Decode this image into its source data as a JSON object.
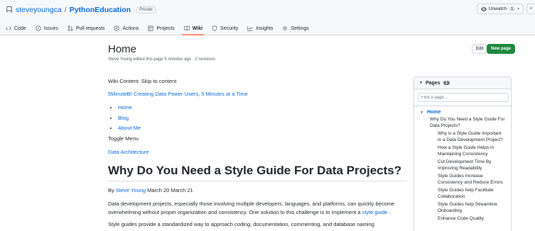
{
  "repo": {
    "owner": "steveyoungca",
    "separator": "/",
    "name": "PythonEducation",
    "visibility": "Private",
    "unwatch_label": "Unwatch",
    "watch_count": "1",
    "fork_partial": "⑂"
  },
  "nav": {
    "tabs": [
      {
        "label": "Code",
        "icon": "code-icon"
      },
      {
        "label": "Issues",
        "icon": "issue-icon"
      },
      {
        "label": "Pull requests",
        "icon": "pull-request-icon"
      },
      {
        "label": "Actions",
        "icon": "play-icon"
      },
      {
        "label": "Projects",
        "icon": "table-icon"
      },
      {
        "label": "Wiki",
        "icon": "book-icon",
        "active": true
      },
      {
        "label": "Security",
        "icon": "shield-icon"
      },
      {
        "label": "Insights",
        "icon": "graph-icon"
      },
      {
        "label": "Settings",
        "icon": "gear-icon"
      }
    ],
    "accent": "#fd8c73"
  },
  "page": {
    "title": "Home",
    "meta": "Steve Young edited this page 5 minutes ago · 2 revisions",
    "edit_label": "Edit",
    "new_page_label": "New page"
  },
  "content": {
    "skip": "Wiki Content: Skip to content",
    "site_link": "5MinuteBI Creating Data Power Users, 5 Minutes at a Time",
    "menu": [
      "Home",
      "Blog",
      "About Me"
    ],
    "toggle": "Toggle Menu",
    "data_arch": "Data Architecture",
    "heading": "Why Do You Need a Style Guide For Data Projects?",
    "by_prefix": "By",
    "author": "Steve Young",
    "dates": "March 20 March 21",
    "p1_text": "Data development projects, especially those involving multiple developers, languages, and platforms, can quickly become overwhelming without proper organization and consistency. One solution to this challenge is to implement a",
    "p1_link": "style guide",
    "p1_end": ".",
    "p2_text": "Style guides provide a standardized way to approach coding, documentation, commenting, and database naming"
  },
  "sidebar": {
    "title": "Pages",
    "count": "1",
    "search_placeholder": "Find a page…",
    "home": "Home",
    "items": [
      {
        "level": 1,
        "label": "Why Do You Need a Style Guide For Data Projects?"
      },
      {
        "level": 2,
        "label": "Why is a Style Guide Important in a Data Development Project?"
      },
      {
        "level": 2,
        "label": "How a Style Guide Helps in Maintaining Consistency"
      },
      {
        "level": 2,
        "label": "Cut Development Time By Improving Readability"
      },
      {
        "level": 2,
        "label": "Style Guides Increase Consistency and Reduce Errors"
      },
      {
        "level": 2,
        "label": "Style Guides help Facilitate Collaboration"
      },
      {
        "level": 2,
        "label": "Style Guides help Streamline Onboarding"
      },
      {
        "level": 2,
        "label": "Enhance Code Quality"
      }
    ]
  },
  "colors": {
    "link": "#0969da",
    "primary_button": "#1f883d",
    "border": "#d0d7de",
    "header_bg": "#f6f8fa"
  }
}
